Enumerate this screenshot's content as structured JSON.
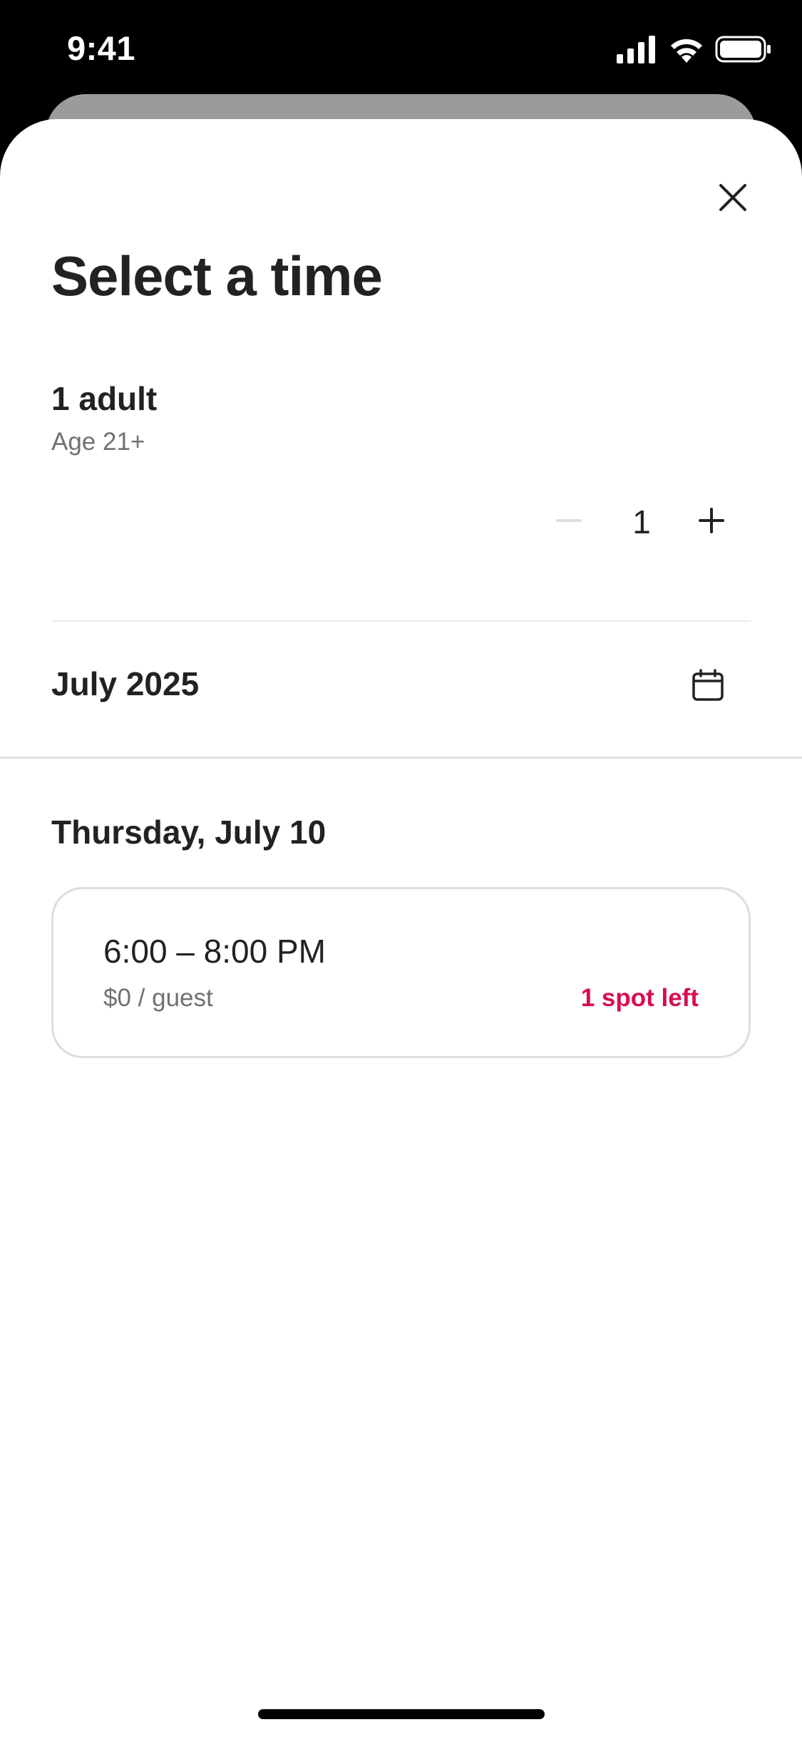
{
  "status_bar": {
    "time": "9:41"
  },
  "sheet": {
    "title": "Select a time",
    "guests": {
      "label": "1 adult",
      "sublabel": "Age 21+",
      "count": "1"
    },
    "month": "July 2025",
    "day_header": "Thursday, July 10",
    "slots": [
      {
        "time": "6:00 – 8:00 PM",
        "price": "$0  / guest",
        "availability": "1 spot left",
        "availability_color": "#d70d4e"
      }
    ]
  }
}
